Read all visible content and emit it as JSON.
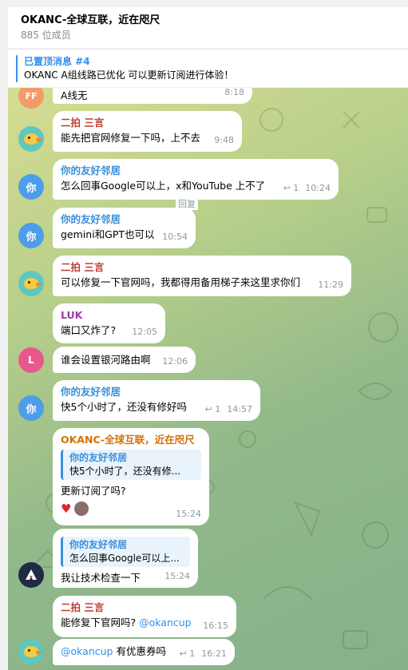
{
  "header": {
    "title": "OKANC-全球互联，近在咫尺",
    "subtitle": "885 位成员"
  },
  "pinned": {
    "title": "已置顶消息 #4",
    "text": "OKANC A组线路已优化 可以更新订阅进行体验！"
  },
  "tooltip": "回复",
  "messages": [
    {
      "avatar": "FF",
      "text": "A线无",
      "time": "8:18"
    },
    {
      "avatar": "",
      "sender": "二拍 三言",
      "text": "能先把官网修复一下吗，上不去",
      "time": "9:48"
    },
    {
      "avatar": "你",
      "sender": "你的友好邻居",
      "text": "怎么回事Google可以上，x和YouTube 上不了",
      "replies": "1",
      "time": "10:24"
    },
    {
      "avatar": "你",
      "sender": "你的友好邻居",
      "text": "gemini和GPT也可以",
      "time": "10:54"
    },
    {
      "avatar": "",
      "sender": "二拍 三言",
      "text": "可以修复一下官网吗，我都得用备用梯子来这里求你们",
      "time": "11:29"
    },
    {
      "sender": "LUK",
      "text": "端口又炸了?",
      "time": "12:05"
    },
    {
      "avatar": "L",
      "text": "谁会设置银河路由啊",
      "time": "12:06"
    },
    {
      "avatar": "你",
      "sender": "你的友好邻居",
      "text": "快5个小时了，还没有修好吗",
      "replies": "1",
      "time": "14:57"
    },
    {
      "sender": "OKANC-全球互联，近在咫尺",
      "quote_name": "你的友好邻居",
      "quote_text": "快5个小时了，还没有修...",
      "text": "更新订阅了吗?",
      "time": "15:24",
      "reaction": "♥"
    },
    {
      "avatar": "",
      "quote_name": "你的友好邻居",
      "quote_text": "怎么回事Google可以上...",
      "text": "我让技术检查一下",
      "time": "15:24"
    },
    {
      "sender": "二拍 三言",
      "text": "能修复下官网吗?",
      "mention": "@okancup",
      "time": "16:15"
    },
    {
      "avatar": "",
      "mention": "@okancup",
      "text": "有优惠券吗",
      "replies": "1",
      "time": "16:21"
    }
  ]
}
